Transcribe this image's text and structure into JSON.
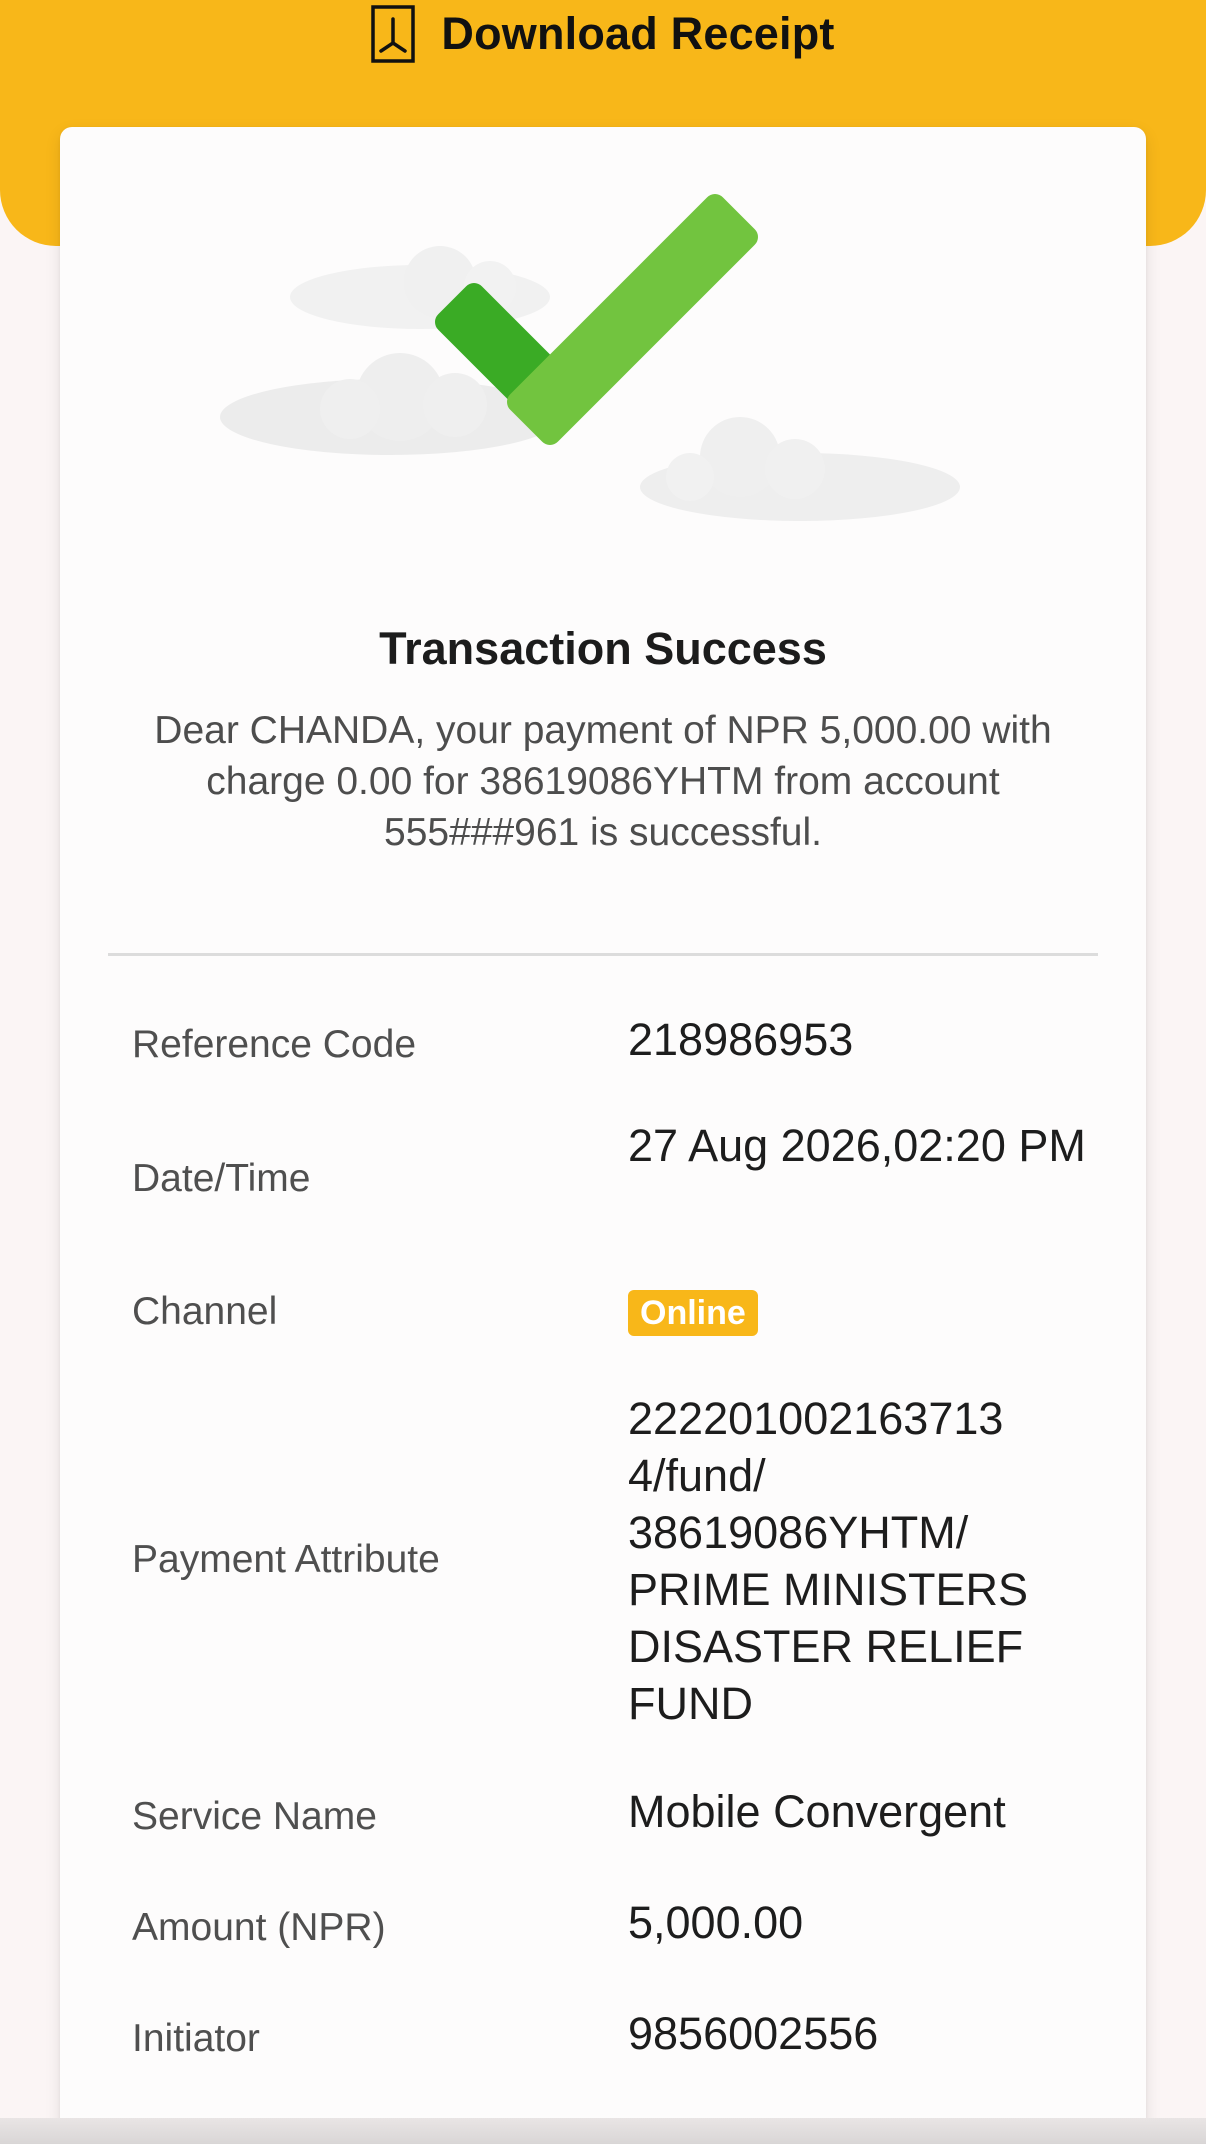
{
  "header": {
    "download_label": "Download Receipt"
  },
  "receipt": {
    "title": "Transaction Success",
    "message": "Dear CHANDA, your payment of NPR 5,000.00 with charge 0.00 for 38619086YHTM from account 555###961 is successful.",
    "rows": [
      {
        "label": "Reference Code",
        "value": "218986953"
      },
      {
        "label": "Date/Time",
        "value": "27 Aug 2026,02:20 PM"
      },
      {
        "label": "Channel",
        "value": "Online"
      },
      {
        "label": "Payment Attribute",
        "value": "222201002163713 4/fund/ 38619086YHTM/ PRIME MINISTERS DISASTER RELIEF FUND"
      },
      {
        "label": "Service Name",
        "value": "Mobile Convergent"
      },
      {
        "label": "Amount (NPR)",
        "value": "5,000.00"
      },
      {
        "label": "Initiator",
        "value": "9856002556"
      }
    ]
  },
  "colors": {
    "accent": "#f8b719",
    "check_green_dark": "#3aab25",
    "check_green_light": "#72c43f",
    "background": "#fbf5f5"
  },
  "icons": {
    "download": "pdf-icon",
    "success": "checkmark-icon"
  }
}
